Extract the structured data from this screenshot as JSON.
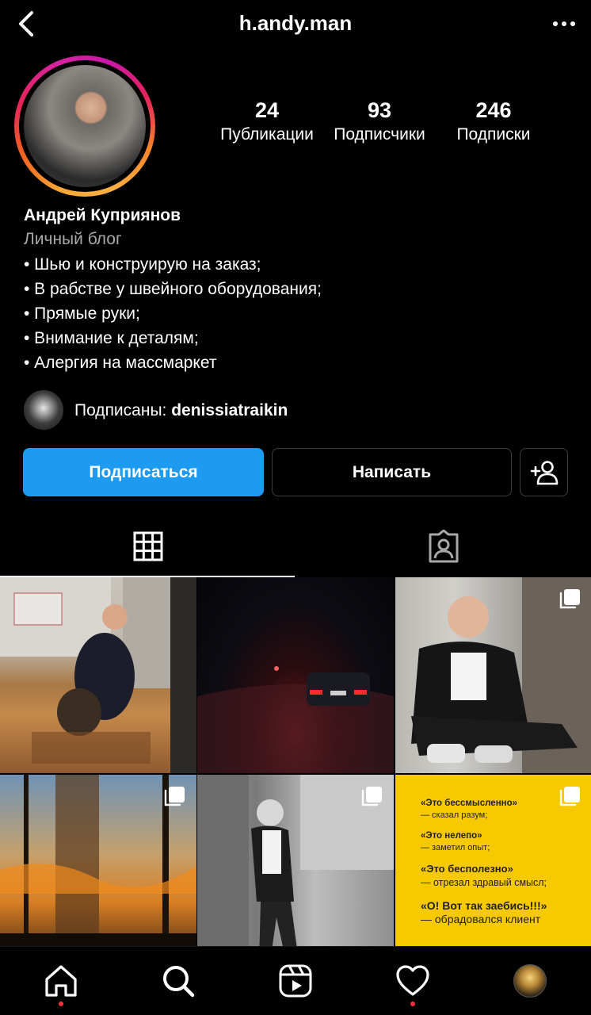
{
  "header": {
    "username": "h.andy.man",
    "back_icon": "chevron-left-icon",
    "more_icon": "more-horizontal-icon"
  },
  "profile": {
    "stats": [
      {
        "value": "24",
        "label": "Публикации"
      },
      {
        "value": "93",
        "label": "Подписчики"
      },
      {
        "value": "246",
        "label": "Подписки"
      }
    ],
    "name": "Андрей Куприянов",
    "category": "Личный блог",
    "bio_lines": [
      "• Шью и конструирую на заказ;",
      "• В рабстве у швейного оборудования;",
      "• Прямые руки;",
      "• Внимание к деталям;",
      "• Алергия на массмаркет"
    ],
    "followed_by_prefix": "Подписаны: ",
    "followed_by_user": "denissiatraikin"
  },
  "actions": {
    "follow_label": "Подписаться",
    "message_label": "Написать",
    "follow_color": "#1c9bf0"
  },
  "tabs": [
    {
      "name": "posts-grid",
      "icon": "grid-icon",
      "active": true
    },
    {
      "name": "tagged",
      "icon": "tagged-person-icon",
      "active": false
    }
  ],
  "grid": {
    "quote_post": {
      "lines": [
        {
          "style": "bold",
          "text": "«Это бессмысленно»"
        },
        {
          "style": "small",
          "text": "— сказал разум;"
        },
        {
          "style": "bold",
          "text": "«Это нелепо»"
        },
        {
          "style": "small",
          "text": "— заметил опыт;"
        },
        {
          "style": "bigbold",
          "text": "«Это бесполезно»"
        },
        {
          "style": "big",
          "text": "— отрезал здравый смысл;"
        },
        {
          "style": "bigbold",
          "text": "«О! Вот так заебись!!!»"
        },
        {
          "style": "big",
          "text": "— обрадовался клиент"
        }
      ]
    }
  },
  "bottom_nav": [
    {
      "icon": "home-icon",
      "dot": true
    },
    {
      "icon": "search-icon",
      "dot": false
    },
    {
      "icon": "reels-icon",
      "dot": false
    },
    {
      "icon": "heart-icon",
      "dot": true
    },
    {
      "icon": "profile-avatar",
      "dot": false
    }
  ]
}
